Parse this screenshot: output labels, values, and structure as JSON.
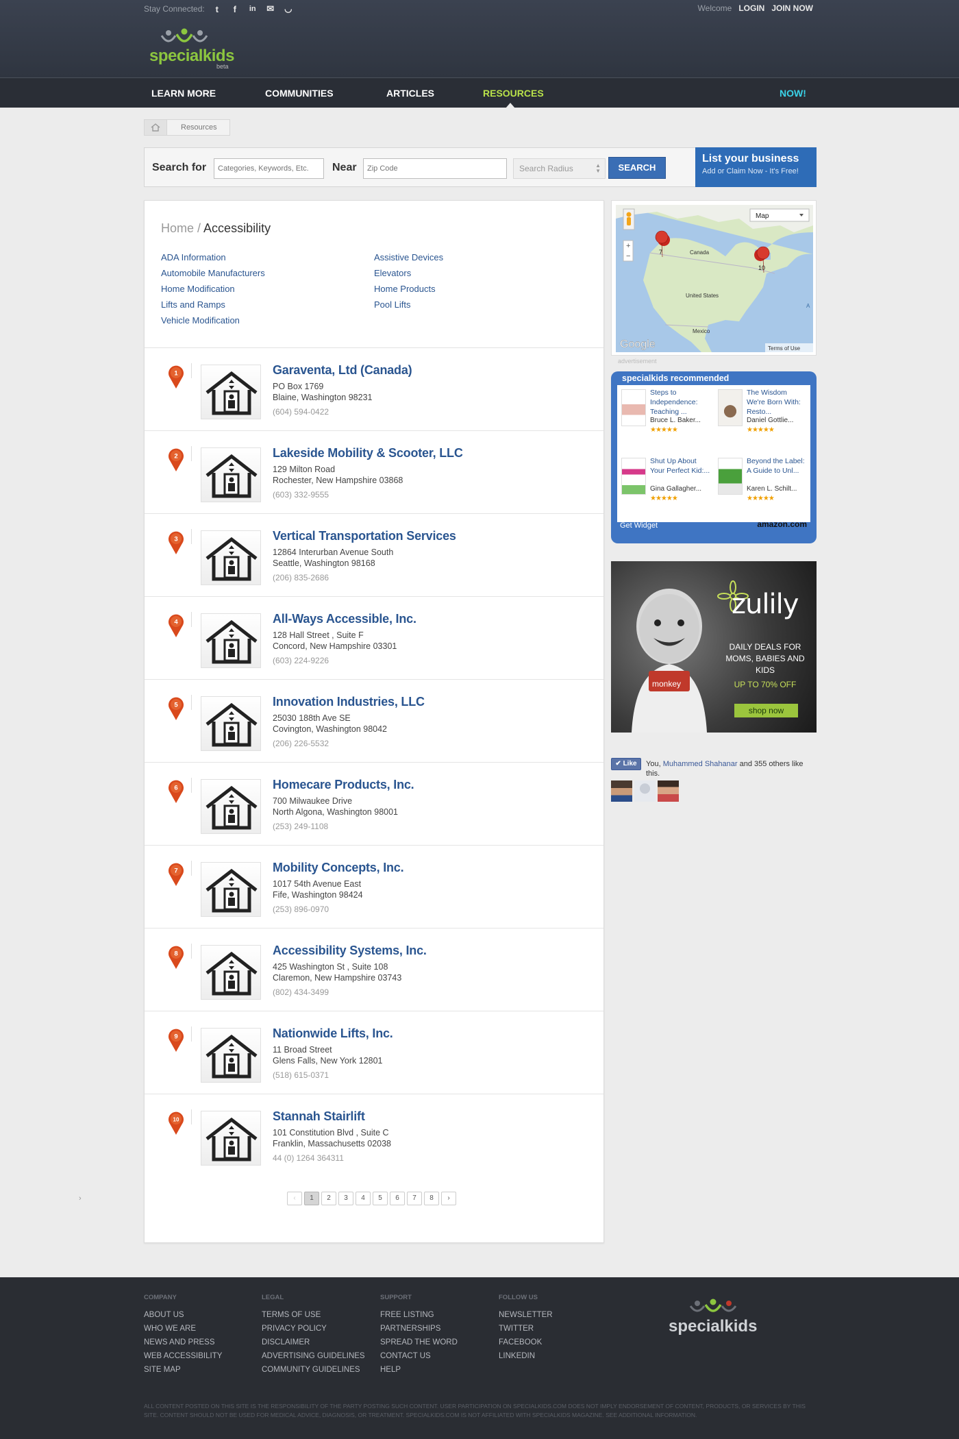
{
  "header": {
    "stay_connected": "Stay Connected:",
    "social_icons": [
      "twitter-icon",
      "facebook-icon",
      "linkedin-icon",
      "email-icon",
      "rss-icon"
    ],
    "welcome": "Welcome",
    "login": "LOGIN",
    "join": "JOIN NOW",
    "logo_text": "specialkids",
    "logo_beta": "beta"
  },
  "nav": {
    "items": [
      "LEARN MORE",
      "COMMUNITIES",
      "ARTICLES",
      "RESOURCES"
    ],
    "now": "NOW!",
    "active_color": "#b9e24a"
  },
  "breadcrumb": {
    "current": "Resources"
  },
  "search": {
    "search_for_label": "Search for",
    "search_for_placeholder": "Categories, Keywords, Etc.",
    "near_label": "Near",
    "near_placeholder": "Zip Code",
    "radius_placeholder": "Search Radius",
    "button": "SEARCH"
  },
  "list_business": {
    "title": "List your business",
    "subtitle": "Add or Claim Now - It's Free!"
  },
  "category": {
    "home": "Home /",
    "title": "Accessibility",
    "links_left": [
      "ADA Information",
      "Automobile Manufacturers",
      "Home Modification",
      "Lifts and Ramps",
      "Vehicle Modification"
    ],
    "links_right": [
      "Assistive Devices",
      "Elevators",
      "Home Products",
      "Pool Lifts"
    ]
  },
  "results": [
    {
      "num": "1",
      "name": "Garaventa, Ltd (Canada)",
      "addr1": "PO Box 1769",
      "addr2": "Blaine, Washington 98231",
      "phone": "(604) 594-0422"
    },
    {
      "num": "2",
      "name": "Lakeside Mobility & Scooter, LLC",
      "addr1": "129 Milton Road",
      "addr2": "Rochester, New Hampshire 03868",
      "phone": "(603) 332-9555"
    },
    {
      "num": "3",
      "name": "Vertical Transportation Services",
      "addr1": "12864 Interurban Avenue South",
      "addr2": "Seattle, Washington 98168",
      "phone": "(206) 835-2686"
    },
    {
      "num": "4",
      "name": "All-Ways Accessible, Inc.",
      "addr1": "128 Hall Street , Suite F",
      "addr2": "Concord, New Hampshire 03301",
      "phone": "(603) 224-9226"
    },
    {
      "num": "5",
      "name": "Innovation Industries, LLC",
      "addr1": "25030 188th Ave SE",
      "addr2": "Covington, Washington 98042",
      "phone": "(206) 226-5532"
    },
    {
      "num": "6",
      "name": "Homecare Products, Inc.",
      "addr1": "700 Milwaukee Drive",
      "addr2": "North Algona, Washington 98001",
      "phone": "(253) 249-1108"
    },
    {
      "num": "7",
      "name": "Mobility Concepts, Inc.",
      "addr1": "1017 54th Avenue East",
      "addr2": "Fife, Washington 98424",
      "phone": "(253) 896-0970"
    },
    {
      "num": "8",
      "name": "Accessibility Systems, Inc.",
      "addr1": "425 Washington St , Suite 108",
      "addr2": "Claremon, New Hampshire 03743",
      "phone": "(802) 434-3499"
    },
    {
      "num": "9",
      "name": "Nationwide Lifts, Inc.",
      "addr1": "11 Broad Street",
      "addr2": "Glens Falls, New York 12801",
      "phone": "(518) 615-0371"
    },
    {
      "num": "10",
      "name": "Stannah Stairlift",
      "addr1": "101 Constitution Blvd , Suite C",
      "addr2": "Franklin, Massachusetts 02038",
      "phone": "44 (0) 1264 364311"
    }
  ],
  "pager": {
    "pages": [
      "1",
      "2",
      "3",
      "4",
      "5",
      "6",
      "7",
      "8"
    ],
    "current": "1",
    "prev": "‹",
    "next": "›"
  },
  "side_chevron": "›",
  "map": {
    "type_button": "Map",
    "label_canada": "Canada",
    "label_us": "United States",
    "label_mexico": "Mexico",
    "google": "Google",
    "terms": "Terms of Use",
    "cluster_left": "7",
    "cluster_right": "10",
    "zoom_in": "+",
    "zoom_out": "−",
    "edge_a": "A"
  },
  "advert_label": "advertisement",
  "widget": {
    "title": "specialkids recommended",
    "books": [
      {
        "title": "Steps to Independence: Teaching ...",
        "author": "Bruce L. Baker...",
        "stars": "★★★★★"
      },
      {
        "title": "The Wisdom We're Born With: Resto...",
        "author": "Daniel Gottlie...",
        "stars": "★★★★★"
      },
      {
        "title": "Shut Up About Your Perfect Kid:...",
        "author": "Gina Gallagher...",
        "stars": "★★★★★"
      },
      {
        "title": "Beyond the Label: A Guide to Unl...",
        "author": "Karen L. Schilt...",
        "stars": "★★★★★"
      }
    ],
    "get_widget": "Get Widget",
    "amazon": "amazon.com"
  },
  "zulily": {
    "logo": "zulily",
    "tagline": "DAILY DEALS FOR MOMS, BABIES AND KIDS",
    "discount": "UP TO 70% OFF",
    "shop": "shop now",
    "shirt_text": "monkey"
  },
  "fb": {
    "like": "Like",
    "text_pre": "You,",
    "name": "Muhammed Shahanar",
    "text_post": "and 355 others like this."
  },
  "footer": {
    "company_head": "COMPANY",
    "company": [
      "ABOUT US",
      "WHO WE ARE",
      "NEWS AND PRESS",
      "WEB ACCESSIBILITY",
      "SITE MAP"
    ],
    "legal_head": "LEGAL",
    "legal": [
      "TERMS OF USE",
      "PRIVACY POLICY",
      "DISCLAIMER",
      "ADVERTISING GUIDELINES",
      "COMMUNITY GUIDELINES"
    ],
    "support_head": "SUPPORT",
    "support": [
      "FREE LISTING",
      "PARTNERSHIPS",
      "SPREAD THE WORD",
      "CONTACT US",
      "HELP"
    ],
    "follow_head": "FOLLOW US",
    "follow": [
      "NEWSLETTER",
      "TWITTER",
      "FACEBOOK",
      "LINKEDIN"
    ],
    "logo_text": "specialkids",
    "disclaimer": "ALL CONTENT POSTED ON THIS SITE IS THE RESPONSIBILITY OF THE PARTY POSTING SUCH CONTENT. USER PARTICIPATION ON SPECIALKIDS.COM DOES NOT IMPLY ENDORSEMENT OF CONTENT, PRODUCTS, OR SERVICES BY THIS SITE. CONTENT SHOULD NOT BE USED FOR MEDICAL ADVICE, DIAGNOSIS, OR TREATMENT. SPECIALKIDS.COM IS NOT AFFILIATED WITH SPECIALKIDS MAGAZINE. SEE ADDITIONAL INFORMATION."
  }
}
